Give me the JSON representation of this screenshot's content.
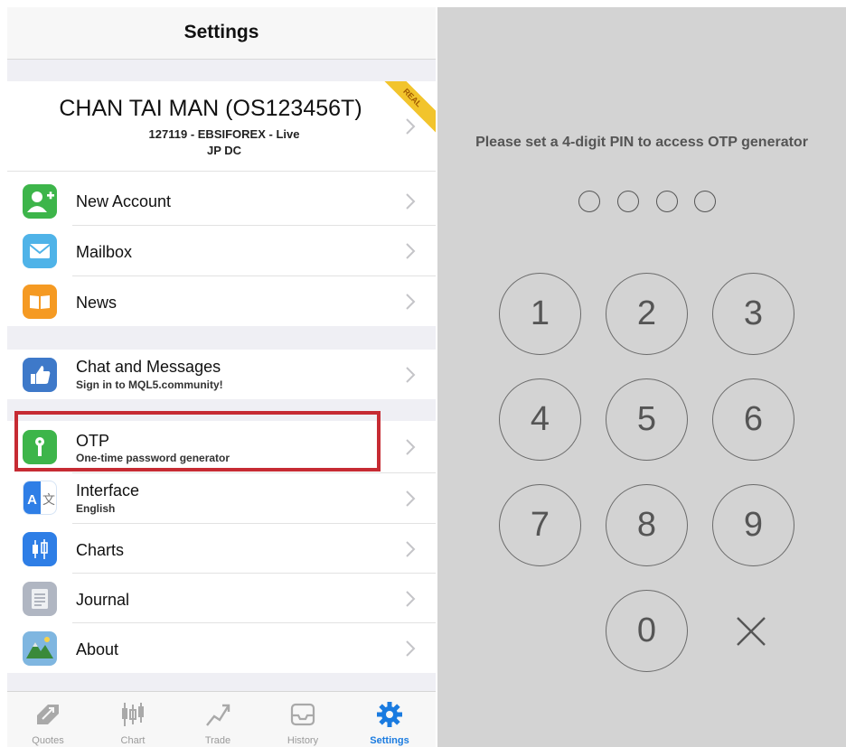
{
  "settings": {
    "header": {
      "title": "Settings"
    },
    "account": {
      "name": "CHAN TAI MAN (OS123456T)",
      "detail_line1": "127119 - EBSIFOREX - Live",
      "detail_line2": "JP DC",
      "badge": "REAL"
    },
    "items": [
      {
        "label": "New Account",
        "icon": "add-user-icon",
        "color": "#3db54a"
      },
      {
        "label": "Mailbox",
        "icon": "mail-icon",
        "color": "#4fb3e8"
      },
      {
        "label": "News",
        "icon": "news-icon",
        "color": "#f59a23"
      },
      {
        "label": "Chat and Messages",
        "sub": "Sign in to MQL5.community!",
        "icon": "thumbs-up-icon",
        "color": "#3e79c9"
      },
      {
        "label": "OTP",
        "sub": "One-time password generator",
        "icon": "key-icon",
        "color": "#3db54a"
      },
      {
        "label": "Interface",
        "sub": "English",
        "icon": "translate-icon",
        "color": "#2e7ee6"
      },
      {
        "label": "Charts",
        "icon": "candlestick-icon",
        "color": "#2e7ee6"
      },
      {
        "label": "Journal",
        "icon": "journal-icon",
        "color": "#b0b6c2"
      },
      {
        "label": "About",
        "icon": "about-logo-icon",
        "color": "#7fb6e0"
      }
    ],
    "tabs": [
      {
        "label": "Quotes",
        "icon": "quotes-icon"
      },
      {
        "label": "Chart",
        "icon": "chart-icon"
      },
      {
        "label": "Trade",
        "icon": "trade-icon"
      },
      {
        "label": "History",
        "icon": "history-icon"
      },
      {
        "label": "Settings",
        "icon": "gear-icon",
        "active": true
      }
    ],
    "highlight_color": "#c62b33",
    "accent_color": "#1a7be0"
  },
  "pin": {
    "prompt": "Please set a 4-digit PIN to access OTP generator",
    "keys": [
      "1",
      "2",
      "3",
      "4",
      "5",
      "6",
      "7",
      "8",
      "9",
      "0"
    ],
    "delete_icon": "close-icon",
    "background": "#d3d3d3"
  }
}
